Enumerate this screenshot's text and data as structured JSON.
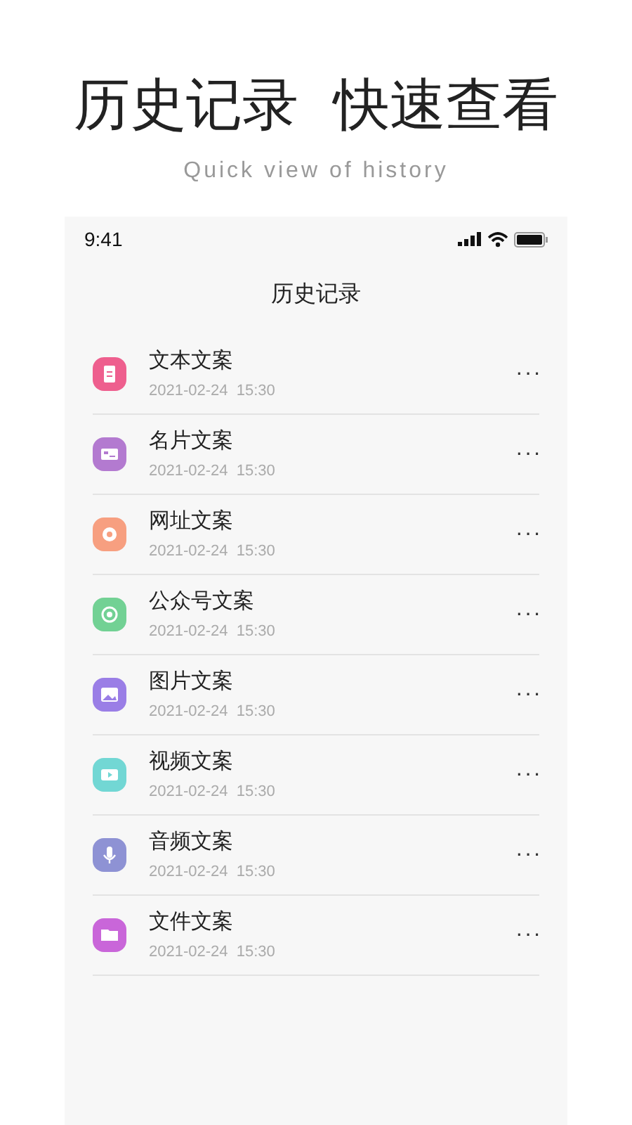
{
  "headline": "历史记录  快速查看",
  "subtitle": "Quick view of history",
  "status_bar": {
    "time": "9:41"
  },
  "title": "历史记录",
  "items": [
    {
      "name": "文本文案",
      "time": "2021-02-24  15:30",
      "kind": "document",
      "color": "#ee5f8e"
    },
    {
      "name": "名片文案",
      "time": "2021-02-24  15:30",
      "kind": "card",
      "color": "#b37ad0"
    },
    {
      "name": "网址文案",
      "time": "2021-02-24  15:30",
      "kind": "link",
      "color": "#f79f80"
    },
    {
      "name": "公众号文案",
      "time": "2021-02-24  15:30",
      "kind": "account",
      "color": "#72d194"
    },
    {
      "name": "图片文案",
      "time": "2021-02-24  15:30",
      "kind": "image",
      "color": "#9a7ee6"
    },
    {
      "name": "视频文案",
      "time": "2021-02-24  15:30",
      "kind": "video",
      "color": "#72d7d4"
    },
    {
      "name": "音频文案",
      "time": "2021-02-24  15:30",
      "kind": "audio",
      "color": "#8e92d4"
    },
    {
      "name": "文件文案",
      "time": "2021-02-24  15:30",
      "kind": "folder",
      "color": "#c966d9"
    }
  ],
  "more_label": "···"
}
